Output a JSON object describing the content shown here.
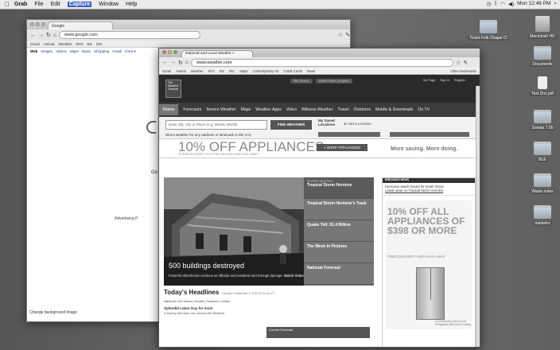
{
  "menubar": {
    "apple": "",
    "items": [
      "Grab",
      "File",
      "Edit",
      "Capture",
      "Window",
      "Help"
    ],
    "clock": "Mon 12:46 PM"
  },
  "desktop_icons": [
    {
      "label": "Ticket Folk Chapel Cl",
      "kind": "folder"
    },
    {
      "label": "Macintosh HD",
      "kind": "drive"
    },
    {
      "label": "Documents",
      "kind": "folder"
    },
    {
      "label": "Text Doc.pdf",
      "kind": "file"
    },
    {
      "label": "Sonata 7.0b",
      "kind": "folder"
    },
    {
      "label": "BLE",
      "kind": "folder"
    },
    {
      "label": "Waste notes",
      "kind": "folder"
    },
    {
      "label": "marketrs",
      "kind": "folder"
    }
  ],
  "google_window": {
    "tab_title": "Google",
    "url": "www.google.com",
    "bookmarks": [
      "Gmail",
      "Animal",
      "Weather",
      "MTA",
      "Etc",
      "INC"
    ],
    "nav": [
      "Web",
      "Images",
      "Videos",
      "Maps",
      "News",
      "Shopping",
      "Gmail",
      "more ▾"
    ],
    "advertising": "Advertising P",
    "g_text": "Go",
    "footer": "Change background image"
  },
  "weather_window": {
    "tab_title": "National and Local Weathe",
    "url": "www.weather.com",
    "bookmarks": [
      "Gmail",
      "Animal",
      "Weather",
      "MTA",
      "Etc",
      "INC",
      "Maps",
      "Contemporary Art",
      "Credit Cards",
      "News"
    ],
    "other_bookmarks": "Other Bookmarks",
    "header_fields": [
      "Site Search",
      "United States (English)"
    ],
    "header_links": [
      "My Page",
      "Sign In",
      "Register"
    ],
    "logo": "The Weather Channel",
    "nav": [
      "Home",
      "Forecasts",
      "Severe Weather",
      "Maps",
      "Weather Apps",
      "Video",
      "Witness Weather",
      "Travel",
      "Outdoors",
      "Mobile & Downloads",
      "On TV"
    ],
    "search_placeholder": "Enter Zip, City or Place (e.g. Disney World)",
    "find_button": "FIND WEATHER",
    "saved": "My Saved Locations",
    "add_location": "Add a Location",
    "search_sub": "Direct weather for any address or landmark in the U.S.",
    "ad": {
      "headline": "10% OFF APPLIANCES",
      "sub": "OF $398 OR MORE, PLUS FREE DELIVERY AND HAUL-AWAY",
      "shop": "» SHOP APPLIANCES",
      "tagline": "More saving. More doing."
    },
    "hero": {
      "caption": "500 buildings destroyed",
      "desc": "Powerful aftershocks continue as officials and residents sort through damage.",
      "watch": "Watch Video"
    },
    "side_items": [
      {
        "tag": "SEVERE WEATHER",
        "title": "Tropical Storm Hermine"
      },
      {
        "tag": "",
        "title": "Tropical Storm Hermine's Track"
      },
      {
        "tag": "",
        "title": "Quake Toll: $1.4 Billion"
      },
      {
        "tag": "",
        "title": "The Week In Pictures"
      },
      {
        "tag": "",
        "title": "National Forecast"
      }
    ],
    "breaking": "BREAKING NEWS",
    "hurricane": "Hurricane watch issued for South Texas",
    "hurricane_link": "Latest news on Tropical Storm Hermine",
    "right_ad": {
      "headline": "10% OFF ALL APPLIANCES OF $398 OR MORE",
      "sub": "FREE DELIVERY AND HAUL-AWAY",
      "fine": "LG Electronics French Door Refrigerator with Smart Cooling"
    },
    "headlines": {
      "title": "Today's Headlines",
      "updated": "Updated: September 6, 2010 12:04 pm ET",
      "cats": "National | Int'l News | Health | Outdoors | Video",
      "story": "Splendid Labor Day for most",
      "story_sub": "A stormy wet start, sun across the Midwest"
    },
    "current_forecast": "Current Forecast"
  }
}
